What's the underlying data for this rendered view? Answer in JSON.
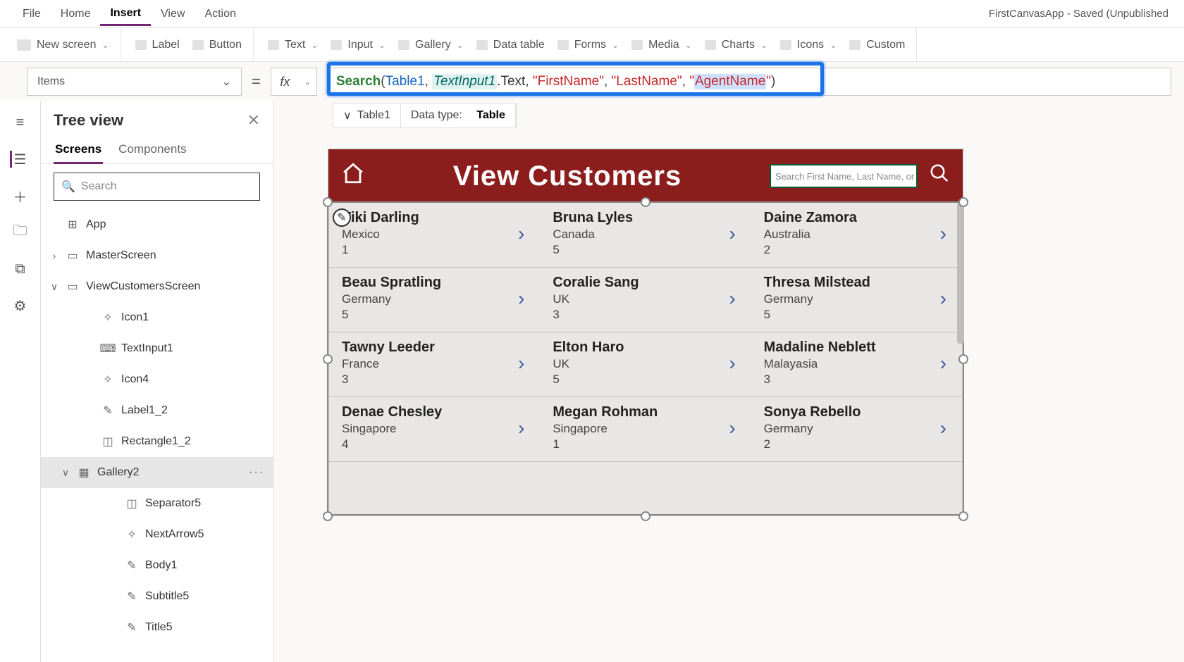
{
  "app_title": "FirstCanvasApp - Saved (Unpublished",
  "menubar": [
    "File",
    "Home",
    "Insert",
    "View",
    "Action"
  ],
  "menubar_active": 2,
  "ribbon": {
    "new_screen": "New screen",
    "label": "Label",
    "button": "Button",
    "text": "Text",
    "input": "Input",
    "gallery": "Gallery",
    "data_table": "Data table",
    "forms": "Forms",
    "media": "Media",
    "charts": "Charts",
    "icons": "Icons",
    "custom": "Custom"
  },
  "property_selected": "Items",
  "formula": {
    "fn": "Search",
    "tbl": "Table1",
    "var": "TextInput1",
    "prop": ".Text",
    "args": [
      "\"FirstName\"",
      "\"LastName\""
    ],
    "sel": "AgentName"
  },
  "hint": {
    "chev": "∨",
    "tbl": "Table1",
    "dtlabel": "Data type:",
    "dtval": "Table"
  },
  "treeview": {
    "title": "Tree view",
    "tabs": [
      "Screens",
      "Components"
    ],
    "tabs_active": 0,
    "search_ph": "Search",
    "nodes": [
      {
        "d": 0,
        "exp": "",
        "icon": "⊞",
        "label": "App"
      },
      {
        "d": 0,
        "exp": "›",
        "icon": "▭",
        "label": "MasterScreen"
      },
      {
        "d": 0,
        "exp": "∨",
        "icon": "▭",
        "label": "ViewCustomersScreen"
      },
      {
        "d": 2,
        "exp": "",
        "icon": "✧",
        "label": "Icon1"
      },
      {
        "d": 2,
        "exp": "",
        "icon": "⌨",
        "label": "TextInput1"
      },
      {
        "d": 2,
        "exp": "",
        "icon": "✧",
        "label": "Icon4"
      },
      {
        "d": 2,
        "exp": "",
        "icon": "✎",
        "label": "Label1_2"
      },
      {
        "d": 2,
        "exp": "",
        "icon": "◫",
        "label": "Rectangle1_2"
      },
      {
        "d": 1,
        "exp": "∨",
        "icon": "▦",
        "label": "Gallery2",
        "sel": true,
        "more": true
      },
      {
        "d": 3,
        "exp": "",
        "icon": "◫",
        "label": "Separator5"
      },
      {
        "d": 3,
        "exp": "",
        "icon": "✧",
        "label": "NextArrow5"
      },
      {
        "d": 3,
        "exp": "",
        "icon": "✎",
        "label": "Body1"
      },
      {
        "d": 3,
        "exp": "",
        "icon": "✎",
        "label": "Subtitle5"
      },
      {
        "d": 3,
        "exp": "",
        "icon": "✎",
        "label": "Title5"
      }
    ]
  },
  "preview": {
    "title": "View Customers",
    "search_ph": "Search First Name, Last Name, or Age",
    "rows": [
      [
        {
          "name": "Viki  Darling",
          "country": "Mexico",
          "num": "1"
        },
        {
          "name": "Bruna  Lyles",
          "country": "Canada",
          "num": "5"
        },
        {
          "name": "Daine  Zamora",
          "country": "Australia",
          "num": "2"
        }
      ],
      [
        {
          "name": "Beau  Spratling",
          "country": "Germany",
          "num": "5"
        },
        {
          "name": "Coralie  Sang",
          "country": "UK",
          "num": "3"
        },
        {
          "name": "Thresa  Milstead",
          "country": "Germany",
          "num": "5"
        }
      ],
      [
        {
          "name": "Tawny  Leeder",
          "country": "France",
          "num": "3"
        },
        {
          "name": "Elton  Haro",
          "country": "UK",
          "num": "5"
        },
        {
          "name": "Madaline  Neblett",
          "country": "Malayasia",
          "num": "3"
        }
      ],
      [
        {
          "name": "Denae  Chesley",
          "country": "Singapore",
          "num": "4"
        },
        {
          "name": "Megan  Rohman",
          "country": "Singapore",
          "num": "1"
        },
        {
          "name": "Sonya  Rebello",
          "country": "Germany",
          "num": "2"
        }
      ]
    ]
  }
}
